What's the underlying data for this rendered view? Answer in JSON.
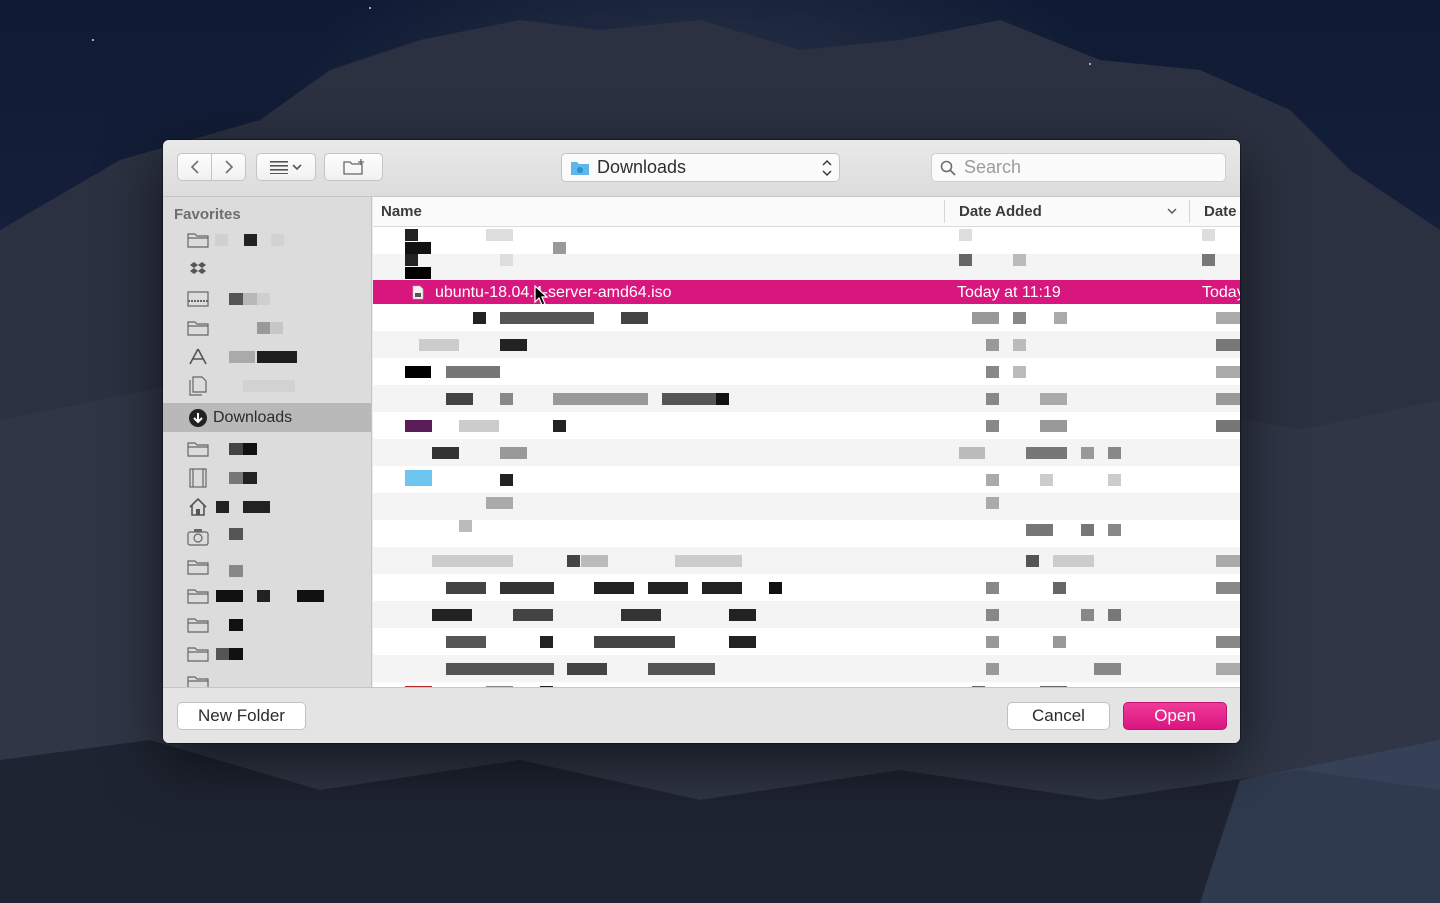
{
  "colors": {
    "accent": "#d8177e",
    "folder": "#5db6ec",
    "selected_sidebar": "#b9b9b9"
  },
  "toolbar": {
    "back_icon": "chevron-left-icon",
    "forward_icon": "chevron-right-icon",
    "view_icon": "list-view-icon",
    "new_folder_icon": "new-folder-icon",
    "location": "Downloads",
    "search_placeholder": "Search"
  },
  "sidebar": {
    "heading": "Favorites",
    "items": [
      {
        "icon": "folder-icon",
        "label": ""
      },
      {
        "icon": "dropbox-icon",
        "label": ""
      },
      {
        "icon": "desktop-icon",
        "label": ""
      },
      {
        "icon": "folder-icon",
        "label": ""
      },
      {
        "icon": "applications-icon",
        "label": ""
      },
      {
        "icon": "documents-icon",
        "label": ""
      },
      {
        "icon": "downloads-icon",
        "label": "Downloads",
        "selected": true
      },
      {
        "icon": "folder-icon",
        "label": ""
      },
      {
        "icon": "movies-icon",
        "label": ""
      },
      {
        "icon": "home-icon",
        "label": ""
      },
      {
        "icon": "camera-icon",
        "label": ""
      },
      {
        "icon": "folder-icon",
        "label": ""
      },
      {
        "icon": "folder-icon",
        "label": ""
      },
      {
        "icon": "folder-icon",
        "label": ""
      },
      {
        "icon": "folder-icon",
        "label": ""
      },
      {
        "icon": "folder-icon",
        "label": ""
      }
    ]
  },
  "columns": {
    "name": "Name",
    "date_added": "Date Added",
    "date": "Date"
  },
  "selected_file": {
    "name": "ubuntu-18.04.4-server-amd64.iso",
    "date_added": "Today at 11:19",
    "date": "Today"
  },
  "footer": {
    "new_folder": "New Folder",
    "cancel": "Cancel",
    "open": "Open"
  }
}
